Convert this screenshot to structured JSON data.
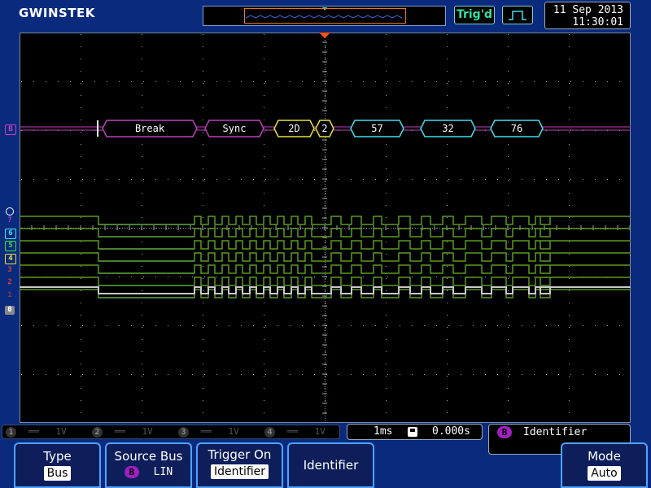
{
  "brand": {
    "logo": "GWINSTEK"
  },
  "header": {
    "trigger_status": "Trig'd",
    "date": "11 Sep 2013",
    "time": "11:30:01"
  },
  "bus": {
    "label": "B",
    "frames": [
      "Break",
      "Sync",
      "2D",
      "2",
      "57",
      "32",
      "76"
    ]
  },
  "channel_markers": [
    "7",
    "6",
    "5",
    "4",
    "3",
    "2",
    "1",
    "0"
  ],
  "channel_status": [
    {
      "num": "1",
      "volts": "1V"
    },
    {
      "num": "2",
      "volts": "1V"
    },
    {
      "num": "3",
      "volts": "1V"
    },
    {
      "num": "4",
      "volts": "1V"
    }
  ],
  "timebase": {
    "scale": "1ms",
    "position": "0.000s"
  },
  "trigger_info": {
    "badge": "B",
    "text": "Identifier"
  },
  "softkeys": {
    "type": {
      "title": "Type",
      "value": "Bus"
    },
    "source_bus": {
      "title": "Source Bus",
      "badge": "B",
      "value": "LIN"
    },
    "trigger_on": {
      "title": "Trigger On",
      "value": "Identifier"
    },
    "identifier": {
      "title": "Identifier"
    },
    "mode": {
      "title": "Mode",
      "value": "Auto"
    }
  },
  "colors": {
    "bus_purple": "#c040c0",
    "bus_yellow": "#e8e040",
    "bus_cyan": "#40e0f0",
    "trace_green": "#5a9a20",
    "trace_blue": "#2a6ac0",
    "trace_gray": "#c8c8c8",
    "trigger_orange": "#ff5010"
  }
}
